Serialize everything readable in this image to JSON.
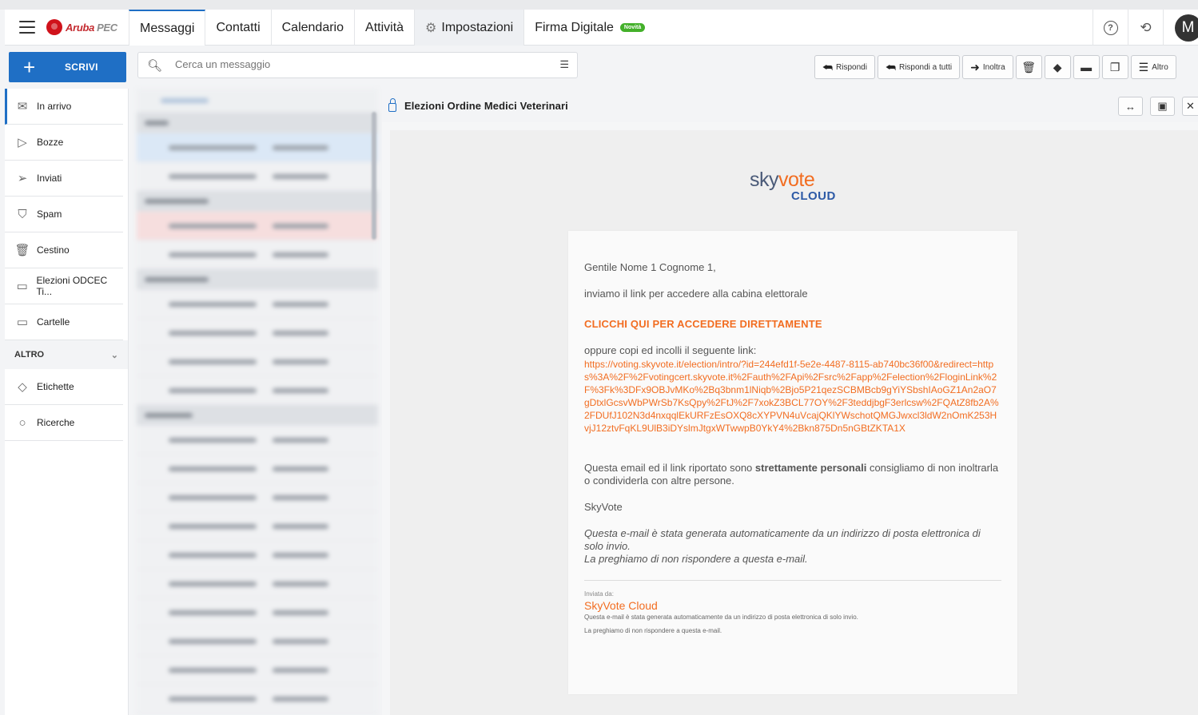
{
  "app": {
    "brand": "Aruba",
    "brand_product": "PEC",
    "avatar_initial": "M",
    "accent_color": "#1f6fc5"
  },
  "nav": {
    "tabs": [
      "Messaggi",
      "Contatti",
      "Calendario",
      "Attività",
      "Impostazioni",
      "Firma Digitale"
    ],
    "new_badge": "Novità"
  },
  "toolbar": {
    "compose_label": "SCRIVI",
    "search_placeholder": "Cerca un messaggio",
    "reply": "Rispondi",
    "reply_all": "Rispondi a tutti",
    "forward": "Inoltra",
    "more": "Altro"
  },
  "sidebar": {
    "folders": [
      "In arrivo",
      "Bozze",
      "Inviati",
      "Spam",
      "Cestino",
      "Elezioni ODCEC Ti...",
      "Cartelle"
    ],
    "section_label": "ALTRO",
    "extra": [
      "Etichette",
      "Ricerche"
    ]
  },
  "message": {
    "subject": "Elezioni Ordine Medici Veterinari",
    "logo_sky": "sky",
    "logo_vote": "vote",
    "logo_cloud": "CLOUD",
    "greeting": "Gentile Nome 1 Cognome 1,",
    "intro": "inviamo il link per accedere alla cabina elettorale",
    "cta": "CLICCHI QUI PER ACCEDERE DIRETTAMENTE",
    "copy_hint": "oppure copi ed incolli il seguente link:",
    "link": "https://voting.skyvote.it/election/intro/?id=244efd1f-5e2e-4487-8115-ab740bc36f00&redirect=https%3A%2F%2Fvotingcert.skyvote.it%2Fauth%2FApi%2Fsrc%2Fapp%2Felection%2FloginLink%2F%3Fk%3DFx9OBJvMKo%2Bq3bnm1lNiqb%2Bjo5P21qezSCBMBcb9gYiYSbshIAoGZ1An2aO7gDtxlGcsvWbPWrSb7KsQpy%2FtJ%2F7xokZ3BCL77OY%2F3teddjbgF3erlcsw%2FQAtZ8fb2A%2FDUfJ102N3d4nxqqlEkURFzEsOXQ8cXYPVN4uVcajQKlYWschotQMGJwxcl3ldW2nOmK253HvjJ12ztvFqKL9UlB3iDYslmJtgxWTwwpB0YkY4%2Bkn875Dn5nGBtZKTA1X",
    "personal_pre": "Questa email ed il link riportato sono ",
    "personal_bold": "strettamente personali",
    "personal_post": " consigliamo di non inoltrarla o condividerla con altre persone.",
    "signature": "SkyVote",
    "auto_line1": "Questa e-mail è stata generata automaticamente da un indirizzo di posta elettronica di solo invio.",
    "auto_line2": "La preghiamo di non rispondere a questa e-mail.",
    "sent_by_label": "Inviata da:",
    "sender": "SkyVote Cloud",
    "footer1": "Questa e-mail è stata generata automaticamente da un indirizzo di posta elettronica di solo invio.",
    "footer2": "La preghiamo di non rispondere a questa e-mail."
  }
}
